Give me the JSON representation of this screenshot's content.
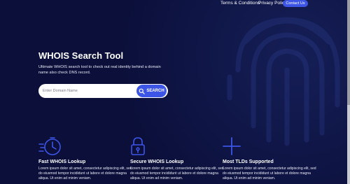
{
  "nav": {
    "terms": "Terms & Conditions",
    "privacy": "Privacy Policy",
    "contact": "Contact Us"
  },
  "hero": {
    "title": "WHOIS Search Tool",
    "description": "Ultimate WHOIS search tool to check out real identity behind a domain name also check DNS record."
  },
  "search": {
    "placeholder": "Enter Domain Name",
    "button_label": "SEARCH"
  },
  "features": [
    {
      "icon": "stopwatch-icon",
      "title": "Fast WHOIS Lookup",
      "description": "Lorem ipsum dolor sit amet, consectetur adipiscing elit, sed do eiusmod tempor incididunt ut labore et dolore magna aliqua. Ut enim ad minim veniam."
    },
    {
      "icon": "padlock-icon",
      "title": "Secure WHOIS Lookup",
      "description": "Lorem ipsum dolor sit amet, consectetur adipiscing elit, sed do eiusmod tempor incididunt ut labore et dolore magna aliqua. Ut enim ad minim veniam."
    },
    {
      "icon": "plus-icon",
      "title": "Most TLDs Supported",
      "description": "Lorem ipsum dolor sit amet, consectetur adipiscing elit, sed do eiusmod tempor incididunt ut labore et dolore magna aliqua. Ut enim ad minim veniam."
    }
  ],
  "colors": {
    "background": "#0b0f3a",
    "accent": "#3d55e6",
    "text": "#ffffff"
  }
}
